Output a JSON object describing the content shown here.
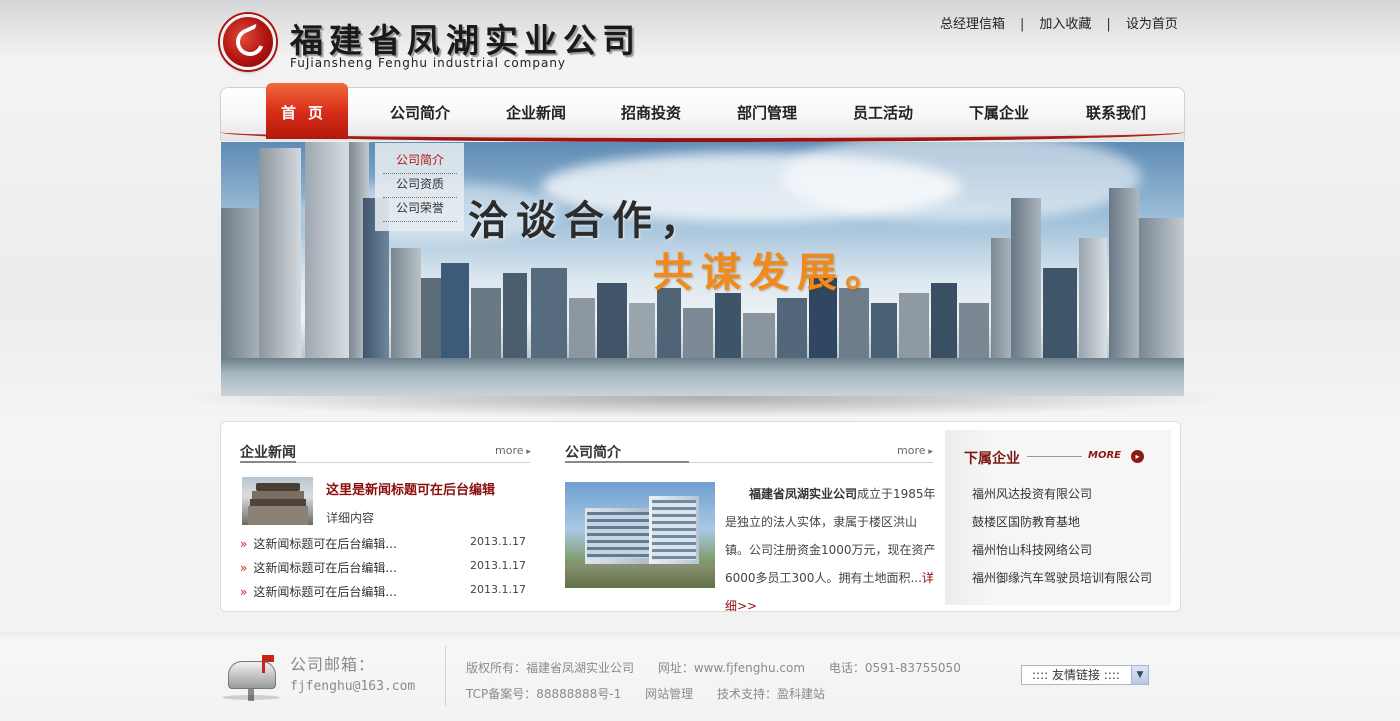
{
  "header": {
    "company_cn": "福建省凤湖实业公司",
    "company_en": "FuJiansheng Fenghu industrial company",
    "links": [
      "总经理信箱",
      "加入收藏",
      "设为首页"
    ],
    "separator": "|"
  },
  "nav": {
    "items": [
      "首页",
      "公司简介",
      "企业新闻",
      "招商投资",
      "部门管理",
      "员工活动",
      "下属企业",
      "联系我们"
    ],
    "active_index": 0
  },
  "dropdown": {
    "items": [
      "公司简介",
      "公司资质",
      "公司荣誉"
    ]
  },
  "banner": {
    "slogan_line1": "洽谈合作，",
    "slogan_line2": "共谋发展。"
  },
  "news": {
    "title": "企业新闻",
    "more": "more",
    "headline": "这里是新闻标题可在后台编辑",
    "detail": "详细内容",
    "bullet": "»",
    "items": [
      {
        "title": "这新闻标题可在后台编辑...",
        "date": "2013.1.17"
      },
      {
        "title": "这新闻标题可在后台编辑...",
        "date": "2013.1.17"
      },
      {
        "title": "这新闻标题可在后台编辑...",
        "date": "2013.1.17"
      }
    ]
  },
  "intro": {
    "title": "公司简介",
    "more": "more",
    "company": "福建省凤湖实业公司",
    "text": "成立于1985年是独立的法人实体，隶属于楼区洪山镇。公司注册资金1000万元，现在资产6000多员工300人。拥有土地面积...",
    "detail_link": "详细>>"
  },
  "subsidiaries": {
    "title": "下属企业",
    "more": "MORE",
    "more_icon": "▸",
    "items": [
      "福州风达投资有限公司",
      "鼓楼区国防教育基地",
      "福州怡山科技网络公司",
      "福州御缘汽车驾驶员培训有限公司"
    ]
  },
  "footer": {
    "mail_label": "公司邮箱：",
    "mail_address": "fjfenghu@163.com",
    "copyright": "版权所有：福建省凤湖实业公司",
    "website": "网址：www.fjfenghu.com",
    "phone": "电话：0591-83755050",
    "icp": "TCP备案号：88888888号-1",
    "admin": "网站管理",
    "support": "技术支持：盈科建站",
    "friend_links": ":::: 友情链接 ::::",
    "friend_arrow": "▼"
  },
  "colors": {
    "brand_red": "#b3180c",
    "headline_red": "#8a0f0c",
    "slogan_orange": "#f08a1c"
  }
}
